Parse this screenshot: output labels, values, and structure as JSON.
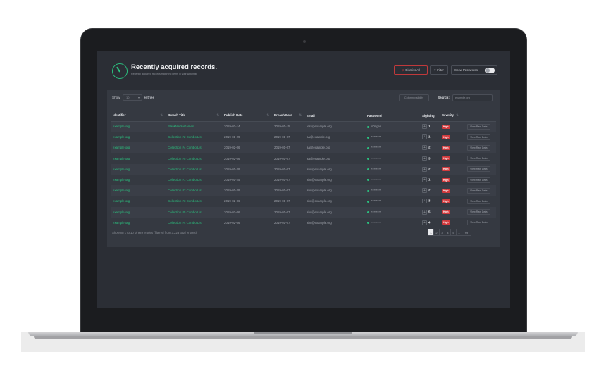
{
  "header": {
    "title": "Recently acquired records.",
    "subtitle": "Recently acquired records matching items in your watchlist",
    "dismiss_label": "Dismiss All",
    "filter_label": "Filter",
    "show_passwords_label": "Show Passwords"
  },
  "controls": {
    "show_label": "Show",
    "show_value": "10",
    "entries_label": "entries",
    "column_visibility_label": "Column visibility",
    "search_label": "Search:",
    "search_placeholder": "example.org"
  },
  "table": {
    "columns": [
      "Identifier",
      "Breach Title",
      "Publish Date",
      "Breach Date",
      "Email",
      "Password",
      "Sighting",
      "Severity",
      ""
    ],
    "rows": [
      {
        "identifier": "example.org",
        "title": "BlankMediaGames",
        "publish": "2019-02-14",
        "breach": "2019-01-15",
        "email": "test@example.org",
        "password": "s0nger",
        "sighting": "1",
        "severity": "High",
        "action": "View Raw Data"
      },
      {
        "identifier": "example.org",
        "title": "Collection #2 Combo List",
        "publish": "2019-01-29",
        "breach": "2019-01-07",
        "email": "aa@example.org",
        "password": "********",
        "sighting": "1",
        "severity": "High",
        "action": "View Raw Data"
      },
      {
        "identifier": "example.org",
        "title": "Collection #4 Combo List",
        "publish": "2019-02-06",
        "breach": "2019-01-07",
        "email": "aa@example.org",
        "password": "********",
        "sighting": "2",
        "severity": "High",
        "action": "View Raw Data"
      },
      {
        "identifier": "example.org",
        "title": "Collection #5 Combo List",
        "publish": "2019-02-06",
        "breach": "2019-01-07",
        "email": "aa@example.org",
        "password": "********",
        "sighting": "3",
        "severity": "High",
        "action": "View Raw Data"
      },
      {
        "identifier": "example.org",
        "title": "Collection #2 Combo List",
        "publish": "2019-01-29",
        "breach": "2019-01-07",
        "email": "abc@example.org",
        "password": "********",
        "sighting": "2",
        "severity": "High",
        "action": "View Raw Data"
      },
      {
        "identifier": "example.org",
        "title": "Collection #1 Combo List",
        "publish": "2019-01-25",
        "breach": "2019-01-07",
        "email": "abc@example.org",
        "password": "********",
        "sighting": "1",
        "severity": "High",
        "action": "View Raw Data"
      },
      {
        "identifier": "example.org",
        "title": "Collection #2 Combo List",
        "publish": "2019-01-29",
        "breach": "2019-01-07",
        "email": "abc@example.org",
        "password": "********",
        "sighting": "2",
        "severity": "High",
        "action": "View Raw Data"
      },
      {
        "identifier": "example.org",
        "title": "Collection #3 Combo List",
        "publish": "2019-02-06",
        "breach": "2019-01-07",
        "email": "abc@example.org",
        "password": "********",
        "sighting": "3",
        "severity": "High",
        "action": "View Raw Data"
      },
      {
        "identifier": "example.org",
        "title": "Collection #5 Combo List",
        "publish": "2019-02-06",
        "breach": "2019-01-07",
        "email": "abc@example.org",
        "password": "********",
        "sighting": "5",
        "severity": "High",
        "action": "View Raw Data"
      },
      {
        "identifier": "example.org",
        "title": "Collection #4 Combo List",
        "publish": "2019-02-06",
        "breach": "2019-01-07",
        "email": "abc@example.org",
        "password": "********",
        "sighting": "4",
        "severity": "High",
        "action": "View Raw Data"
      }
    ]
  },
  "footer": {
    "info": "Showing 1 to 10 of 989 entries (filtered from 3,223 total entries)",
    "pages": [
      "1",
      "2",
      "3",
      "4",
      "5",
      "…",
      "99"
    ]
  },
  "colors": {
    "accent_green": "#2bbf7e",
    "severity_high": "#d23a3d",
    "screen_bg": "#2b2e35",
    "panel_bg": "#353941"
  }
}
